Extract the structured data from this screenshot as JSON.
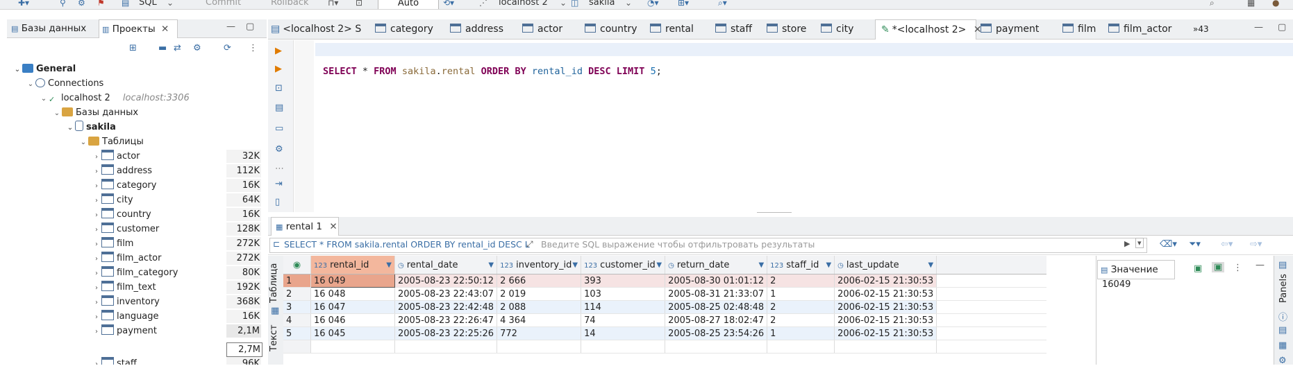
{
  "toolbar": {
    "sql": "SQL",
    "commit": "Commit",
    "rollback": "Rollback",
    "mode": "Auto",
    "connection": "localhost 2",
    "schema": "sakila"
  },
  "left_panel": {
    "tabs": [
      "Базы данных",
      "Проекты"
    ],
    "tree": {
      "general": "General",
      "connections": "Connections",
      "connection_name": "localhost 2",
      "connection_host": "localhost:3306",
      "databases": "Базы данных",
      "db": "sakila",
      "tables_folder": "Таблицы",
      "tables": [
        {
          "name": "actor",
          "size": "32K"
        },
        {
          "name": "address",
          "size": "112K"
        },
        {
          "name": "category",
          "size": "16K"
        },
        {
          "name": "city",
          "size": "64K"
        },
        {
          "name": "country",
          "size": "16K"
        },
        {
          "name": "customer",
          "size": "128K"
        },
        {
          "name": "film",
          "size": "272K"
        },
        {
          "name": "film_actor",
          "size": "272K"
        },
        {
          "name": "film_category",
          "size": "80K"
        },
        {
          "name": "film_text",
          "size": "192K"
        },
        {
          "name": "inventory",
          "size": "368K"
        },
        {
          "name": "language",
          "size": "16K"
        },
        {
          "name": "payment",
          "size": "2,1M"
        },
        {
          "name": "rental",
          "size": "2,7M"
        },
        {
          "name": "staff",
          "size": "96K"
        }
      ]
    }
  },
  "editor_tabs": [
    "<localhost 2> S",
    "category",
    "address",
    "actor",
    "country",
    "rental",
    "staff",
    "store",
    "city",
    "*<localhost 2>",
    "payment",
    "film",
    "film_actor",
    "»43"
  ],
  "editor": {
    "sql_parts": {
      "select": "SELECT",
      "star": " * ",
      "from": "FROM",
      "schema": "sakila",
      "dot": ".",
      "table": "rental",
      "order": "ORDER BY",
      "col": "rental_id",
      "desc": "DESC",
      "limit": "LIMIT",
      "num": "5",
      "semi": ";"
    }
  },
  "results": {
    "tab_label": "rental 1",
    "query_text": "SELECT * FROM sakila.rental ORDER BY rental_id DESC L",
    "filter_placeholder": "Введите SQL выражение чтобы отфильтровать результаты",
    "side_tabs": [
      "Таблица",
      "Текст"
    ],
    "columns": [
      "rental_id",
      "rental_date",
      "inventory_id",
      "customer_id",
      "return_date",
      "staff_id",
      "last_update"
    ],
    "column_types": [
      "123",
      "clock",
      "123",
      "123",
      "clock",
      "123",
      "clock"
    ],
    "rows": [
      [
        "1",
        "16 049",
        "2005-08-23 22:50:12",
        "2 666",
        "393",
        "2005-08-30 01:01:12",
        "2",
        "2006-02-15 21:30:53"
      ],
      [
        "2",
        "16 048",
        "2005-08-23 22:43:07",
        "2 019",
        "103",
        "2005-08-31 21:33:07",
        "1",
        "2006-02-15 21:30:53"
      ],
      [
        "3",
        "16 047",
        "2005-08-23 22:42:48",
        "2 088",
        "114",
        "2005-08-25 02:48:48",
        "2",
        "2006-02-15 21:30:53"
      ],
      [
        "4",
        "16 046",
        "2005-08-23 22:26:47",
        "4 364",
        "74",
        "2005-08-27 18:02:47",
        "2",
        "2006-02-15 21:30:53"
      ],
      [
        "5",
        "16 045",
        "2005-08-23 22:25:26",
        "772",
        "14",
        "2005-08-25 23:54:26",
        "1",
        "2006-02-15 21:30:53"
      ]
    ]
  },
  "value_panel": {
    "title": "Значение",
    "value": "16049",
    "panels_label": "Panels"
  }
}
